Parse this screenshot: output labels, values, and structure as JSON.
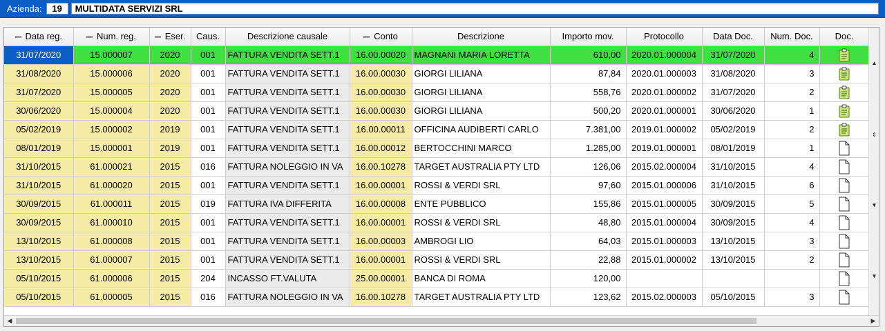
{
  "header": {
    "company_label": "Azienda:",
    "company_code": "19",
    "company_name": "MULTIDATA SERVIZI SRL"
  },
  "columns": [
    "Data reg.",
    "Num. reg.",
    "Eser.",
    "Caus.",
    "Descrizione causale",
    "Conto",
    "Descrizione",
    "Importo mov.",
    "Protocollo",
    "Data Doc.",
    "Num. Doc.",
    "Doc."
  ],
  "rows": [
    {
      "data_reg": "31/07/2020",
      "num_reg": "15.000007",
      "eser": "2020",
      "caus": "001",
      "desc_causale": "FATTURA VENDITA SETT.1",
      "conto": "16.00.00020",
      "descrizione": "MAGNANI MARIA LORETTA",
      "importo": "610,00",
      "protocollo": "2020.01.000004",
      "data_doc": "31/07/2020",
      "num_doc": "4",
      "doc_icon": "clipboard-icon"
    },
    {
      "data_reg": "31/08/2020",
      "num_reg": "15.000006",
      "eser": "2020",
      "caus": "001",
      "desc_causale": "FATTURA VENDITA SETT.1",
      "conto": "16.00.00030",
      "descrizione": "GIORGI LILIANA",
      "importo": "87,84",
      "protocollo": "2020.01.000003",
      "data_doc": "31/08/2020",
      "num_doc": "3",
      "doc_icon": "clipboard-icon"
    },
    {
      "data_reg": "31/07/2020",
      "num_reg": "15.000005",
      "eser": "2020",
      "caus": "001",
      "desc_causale": "FATTURA VENDITA SETT.1",
      "conto": "16.00.00030",
      "descrizione": "GIORGI LILIANA",
      "importo": "558,76",
      "protocollo": "2020.01.000002",
      "data_doc": "31/07/2020",
      "num_doc": "2",
      "doc_icon": "clipboard-icon"
    },
    {
      "data_reg": "30/06/2020",
      "num_reg": "15.000004",
      "eser": "2020",
      "caus": "001",
      "desc_causale": "FATTURA VENDITA SETT.1",
      "conto": "16.00.00030",
      "descrizione": "GIORGI LILIANA",
      "importo": "500,20",
      "protocollo": "2020.01.000001",
      "data_doc": "30/06/2020",
      "num_doc": "1",
      "doc_icon": "clipboard-icon"
    },
    {
      "data_reg": "05/02/2019",
      "num_reg": "15.000002",
      "eser": "2019",
      "caus": "001",
      "desc_causale": "FATTURA VENDITA SETT.1",
      "conto": "16.00.00011",
      "descrizione": "OFFICINA AUDIBERTI CARLO",
      "importo": "7.381,00",
      "protocollo": "2019.01.000002",
      "data_doc": "05/02/2019",
      "num_doc": "2",
      "doc_icon": "clipboard-icon"
    },
    {
      "data_reg": "08/01/2019",
      "num_reg": "15.000001",
      "eser": "2019",
      "caus": "001",
      "desc_causale": "FATTURA VENDITA SETT.1",
      "conto": "16.00.00012",
      "descrizione": "BERTOCCHINI MARCO",
      "importo": "1.285,00",
      "protocollo": "2019.01.000001",
      "data_doc": "08/01/2019",
      "num_doc": "1",
      "doc_icon": "blank-document-icon"
    },
    {
      "data_reg": "31/10/2015",
      "num_reg": "61.000021",
      "eser": "2015",
      "caus": "016",
      "desc_causale": "FATTURA NOLEGGIO IN VA",
      "conto": "16.00.10278",
      "descrizione": "TARGET AUSTRALIA PTY LTD",
      "importo": "126,06",
      "protocollo": "2015.02.000004",
      "data_doc": "31/10/2015",
      "num_doc": "4",
      "doc_icon": "blank-document-icon"
    },
    {
      "data_reg": "31/10/2015",
      "num_reg": "61.000020",
      "eser": "2015",
      "caus": "001",
      "desc_causale": "FATTURA VENDITA SETT.1",
      "conto": "16.00.00001",
      "descrizione": "ROSSI & VERDI SRL",
      "importo": "97,60",
      "protocollo": "2015.01.000006",
      "data_doc": "31/10/2015",
      "num_doc": "6",
      "doc_icon": "blank-document-icon"
    },
    {
      "data_reg": "30/09/2015",
      "num_reg": "61.000011",
      "eser": "2015",
      "caus": "019",
      "desc_causale": "FATTURA IVA DIFFERITA",
      "conto": "16.00.00008",
      "descrizione": "ENTE PUBBLICO",
      "importo": "155,86",
      "protocollo": "2015.01.000005",
      "data_doc": "30/09/2015",
      "num_doc": "5",
      "doc_icon": "blank-document-icon"
    },
    {
      "data_reg": "30/09/2015",
      "num_reg": "61.000010",
      "eser": "2015",
      "caus": "001",
      "desc_causale": "FATTURA VENDITA SETT.1",
      "conto": "16.00.00001",
      "descrizione": "ROSSI & VERDI SRL",
      "importo": "48,80",
      "protocollo": "2015.01.000004",
      "data_doc": "30/09/2015",
      "num_doc": "4",
      "doc_icon": "blank-document-icon"
    },
    {
      "data_reg": "13/10/2015",
      "num_reg": "61.000008",
      "eser": "2015",
      "caus": "001",
      "desc_causale": "FATTURA VENDITA SETT.1",
      "conto": "16.00.00003",
      "descrizione": "AMBROGI LIO",
      "importo": "64,03",
      "protocollo": "2015.01.000003",
      "data_doc": "13/10/2015",
      "num_doc": "3",
      "doc_icon": "blank-document-icon"
    },
    {
      "data_reg": "13/10/2015",
      "num_reg": "61.000007",
      "eser": "2015",
      "caus": "001",
      "desc_causale": "FATTURA VENDITA SETT.1",
      "conto": "16.00.00001",
      "descrizione": "ROSSI & VERDI SRL",
      "importo": "22,88",
      "protocollo": "2015.01.000002",
      "data_doc": "13/10/2015",
      "num_doc": "2",
      "doc_icon": "blank-document-icon"
    },
    {
      "data_reg": "05/10/2015",
      "num_reg": "61.000006",
      "eser": "2015",
      "caus": "204",
      "desc_causale": "INCASSO FT.VALUTA",
      "conto": "25.00.00001",
      "descrizione": "BANCA DI ROMA",
      "importo": "120,00",
      "protocollo": "",
      "data_doc": "",
      "num_doc": "",
      "doc_icon": "blank-document-icon"
    },
    {
      "data_reg": "05/10/2015",
      "num_reg": "61.000005",
      "eser": "2015",
      "caus": "016",
      "desc_causale": "FATTURA NOLEGGIO IN VA",
      "conto": "16.00.10278",
      "descrizione": "TARGET AUSTRALIA PTY LTD",
      "importo": "123,62",
      "protocollo": "2015.02.000003",
      "data_doc": "05/10/2015",
      "num_doc": "3",
      "doc_icon": "blank-document-icon"
    }
  ]
}
